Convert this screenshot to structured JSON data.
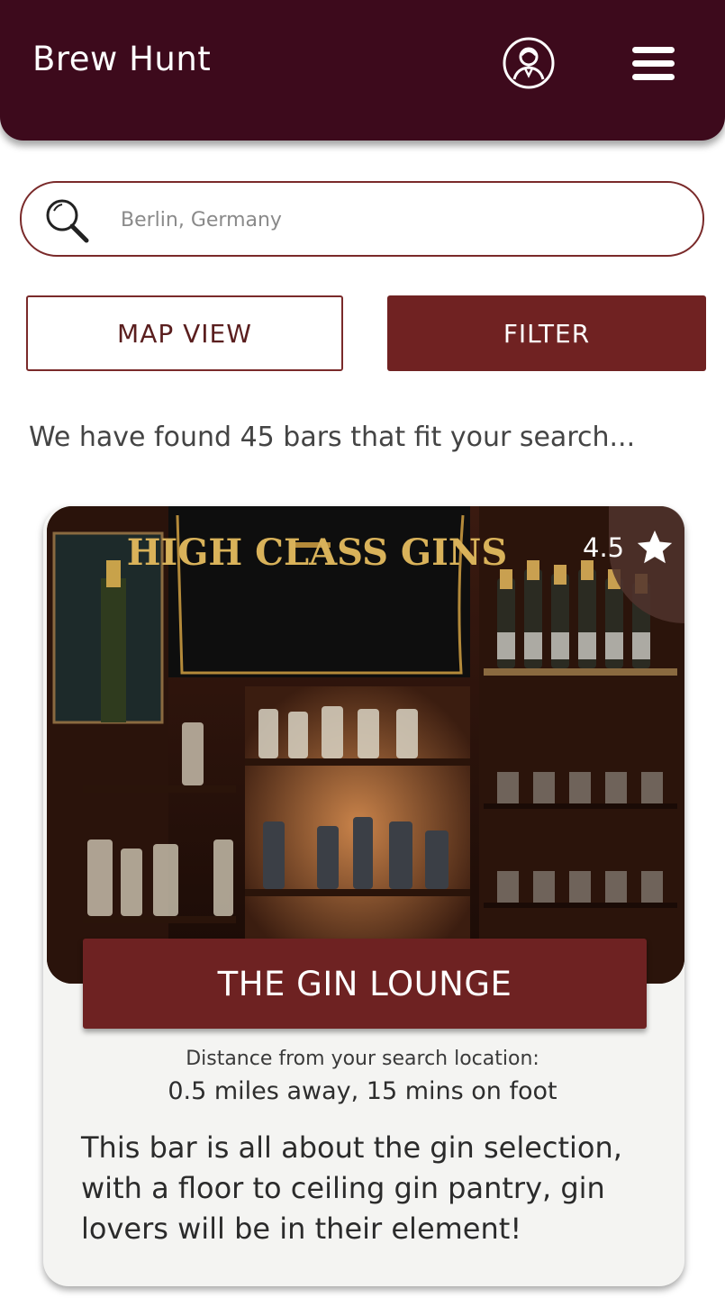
{
  "header": {
    "title": "Brew Hunt",
    "profile_icon": "profile-icon",
    "menu_icon": "hamburger-menu-icon",
    "background": "#3d0a1c"
  },
  "search": {
    "placeholder": "Berlin, Germany",
    "icon": "search-icon"
  },
  "actions": {
    "map_view_label": "MAP VIEW",
    "filter_label": "FILTER",
    "accent": "#702222"
  },
  "results": {
    "summary": "We have found 45 bars that fit your search..."
  },
  "bar_card": {
    "image_alt": "HIGH CLASS GINS",
    "rating": "4.5",
    "rating_icon": "star-icon",
    "name": "THE GIN LOUNGE",
    "distance_label": "Distance from your search location:",
    "distance_value": "0.5 miles away, 15 mins on foot",
    "description": "This bar is all about the gin selection, with a floor to ceiling gin pantry, gin lovers will be in their element!"
  }
}
